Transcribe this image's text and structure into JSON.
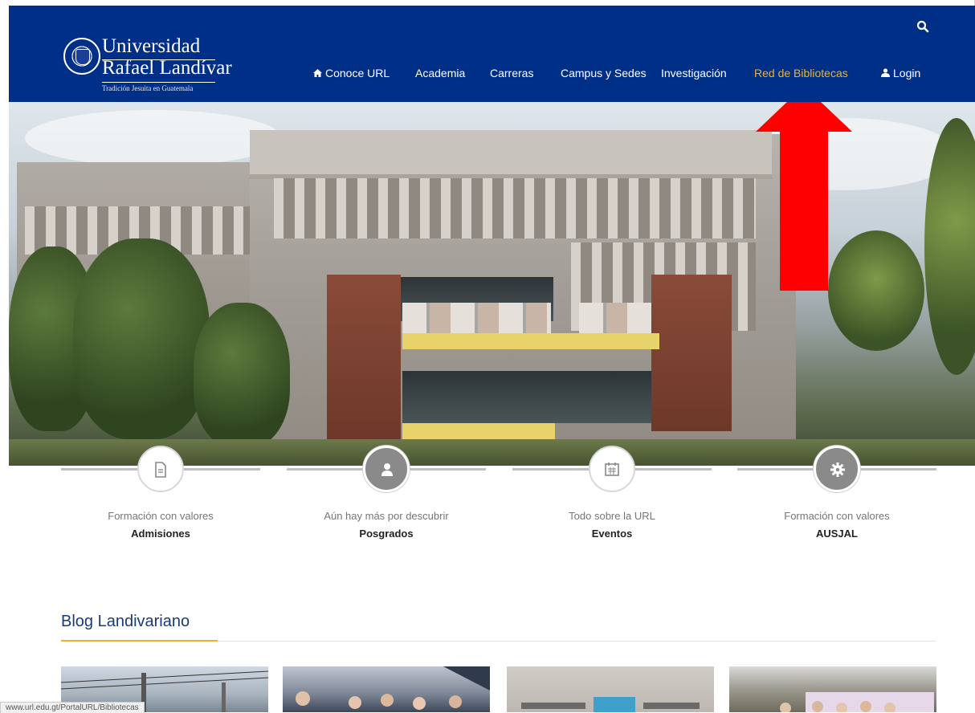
{
  "header": {
    "logo": {
      "line1": "Universidad",
      "line2": "Rafael Landívar",
      "tagline": "Tradición Jesuita en Guatemala"
    },
    "nav": [
      {
        "label": "Conoce URL",
        "icon": "home-icon"
      },
      {
        "label": "Academia"
      },
      {
        "label": "Carreras"
      },
      {
        "label": "Campus y Sedes"
      },
      {
        "label": "Investigación"
      },
      {
        "label": "Red de Bibliotecas",
        "active": true
      },
      {
        "label": "Login",
        "icon": "user-icon"
      }
    ],
    "search_icon": "search-icon",
    "colors": {
      "background": "#002f87",
      "active": "#f0b323",
      "text": "#ffffff"
    }
  },
  "hero": {
    "annotation": {
      "icon": "red-up-arrow",
      "color": "#ff0000"
    }
  },
  "features": [
    {
      "icon": "document-icon",
      "subtitle": "Formación con valores",
      "title": "Admisiones"
    },
    {
      "icon": "person-icon",
      "subtitle": "Aún hay más por descubrir",
      "title": "Posgrados"
    },
    {
      "icon": "calendar-icon",
      "subtitle": "Todo sobre la URL",
      "title": "Eventos"
    },
    {
      "icon": "gear-icon",
      "subtitle": "Formación con valores",
      "title": "AUSJAL"
    }
  ],
  "blog": {
    "title": "Blog Landivariano",
    "accent": "#f0b323"
  },
  "status_bar": {
    "url": "www.url.edu.gt/PortalURL/Bibliotecas"
  }
}
